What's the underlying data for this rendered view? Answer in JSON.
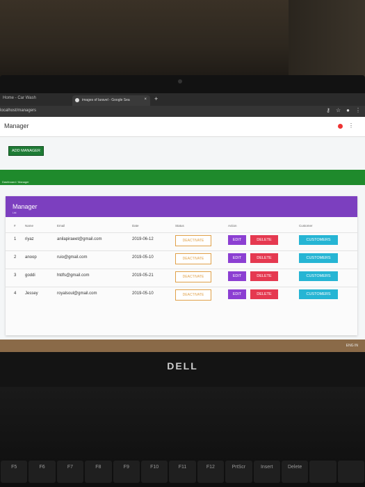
{
  "browser": {
    "left_label": "Home - Car Wash",
    "tab_label": "images of laravel - Google Sea",
    "url": "localhost/managers"
  },
  "app": {
    "title": "Manager",
    "add_button": "ADD MANAGER",
    "green_band_text": "Dashboard / Manager"
  },
  "card": {
    "title": "Manager",
    "subtitle": "List",
    "columns": [
      "#",
      "Name",
      "Email",
      "Date",
      "Status",
      "Action",
      "Customer"
    ],
    "rows": [
      {
        "num": "1",
        "name": "riyaz",
        "email": "anilapiraeet@gmail.com",
        "date": "2019-06-12",
        "status": "DEACTIVATE",
        "edit": "EDIT",
        "delete": "DELETE",
        "customers": "CUSTOMERS"
      },
      {
        "num": "2",
        "name": "anoop",
        "email": "ruio@gmail.com",
        "date": "2019-05-10",
        "status": "DEACTIVATE",
        "edit": "EDIT",
        "delete": "DELETE",
        "customers": "CUSTOMERS"
      },
      {
        "num": "3",
        "name": "goddi",
        "email": "htdfs@gmail.com",
        "date": "2019-05-21",
        "status": "DEACTIVATE",
        "edit": "EDIT",
        "delete": "DELETE",
        "customers": "CUSTOMERS"
      },
      {
        "num": "4",
        "name": "Jessey",
        "email": "royalsoul@gmail.com",
        "date": "2019-05-10",
        "status": "DEACTIVATE",
        "edit": "EDIT",
        "delete": "DELETE",
        "customers": "CUSTOMERS"
      }
    ]
  },
  "footer": {
    "text": "ENG IN"
  },
  "laptop": {
    "brand": "DELL",
    "keys": [
      "F5",
      "F6",
      "F7",
      "F8",
      "F9",
      "F10",
      "F11",
      "F12",
      "PrtScr",
      "Insert",
      "Delete",
      "",
      ""
    ]
  },
  "colors": {
    "purple": "#7c3fbf",
    "green": "#1f8a2c",
    "delete": "#e53950",
    "customers": "#26b5d4"
  }
}
